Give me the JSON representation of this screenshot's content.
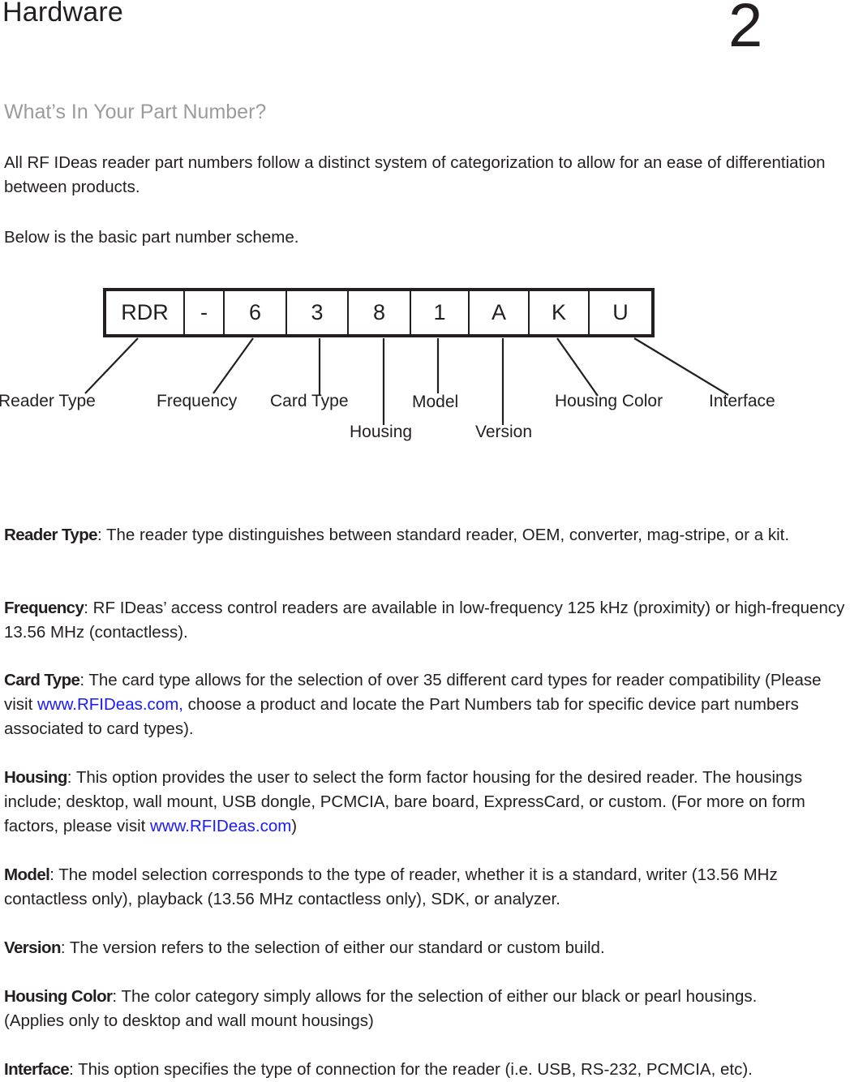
{
  "header": {
    "chapter_title": "Hardware",
    "chapter_number": "2"
  },
  "section": {
    "heading": "What’s In Your Part Number?",
    "intro": "All RF IDeas reader part numbers follow a distinct system of categorization to allow for an ease of differentiation between products.",
    "scheme_intro": "Below is the basic part number scheme."
  },
  "diagram": {
    "segments": [
      "RDR",
      "-",
      "6",
      "3",
      "8",
      "1",
      "A",
      "K",
      "U"
    ],
    "labels": {
      "reader_type": "Reader Type",
      "frequency": "Frequency",
      "card_type": "Card Type",
      "housing": "Housing",
      "model": "Model",
      "version": "Version",
      "housing_color": "Housing Color",
      "interface": "Interface"
    }
  },
  "definitions": [
    {
      "term": "Reader Type",
      "text": ": The reader type distinguishes between standard reader, OEM, converter, mag-stripe, or a kit."
    },
    {
      "term": "Frequency",
      "text": ": RF IDeas’ access control readers are available in low-frequency 125 kHz (proximity) or high-frequency 13.56 MHz (contactless)."
    },
    {
      "term": "Card Type",
      "text_before": ": The card type allows for the selection of over 35 different card types for reader compatibility (Please visit ",
      "link": "www.RFIDeas.com,",
      "text_after": " choose a product and locate the Part Numbers tab for specific device part numbers associated to card types)."
    },
    {
      "term": "Housing",
      "text_before": ": This option provides the user to select the form factor housing for the desired reader. The housings include; desktop, wall mount, USB dongle, PCMCIA, bare board, ExpressCard, or custom. (For more on form factors, please visit ",
      "link": "www.RFIDeas.com",
      "text_after": ")"
    },
    {
      "term": "Model",
      "text": ": The model selection corresponds to the type of reader, whether it is a standard, writer (13.56 MHz contactless only), playback (13.56 MHz contactless only), SDK, or analyzer."
    },
    {
      "term": "Version",
      "text": ": The version refers to the selection of either our standard or custom build."
    },
    {
      "term": "Housing Color",
      "text": ": The color category simply allows for the selection of either our black or pearl housings. (Applies only to desktop and wall mount housings)"
    },
    {
      "term": "Interface",
      "text": ": This option specifies the type of connection for the reader (i.e. USB, RS-232, PCMCIA, etc)."
    }
  ],
  "colors": {
    "text": "#231f20",
    "subheading": "#9b9b9b",
    "link": "#1a1aff"
  }
}
